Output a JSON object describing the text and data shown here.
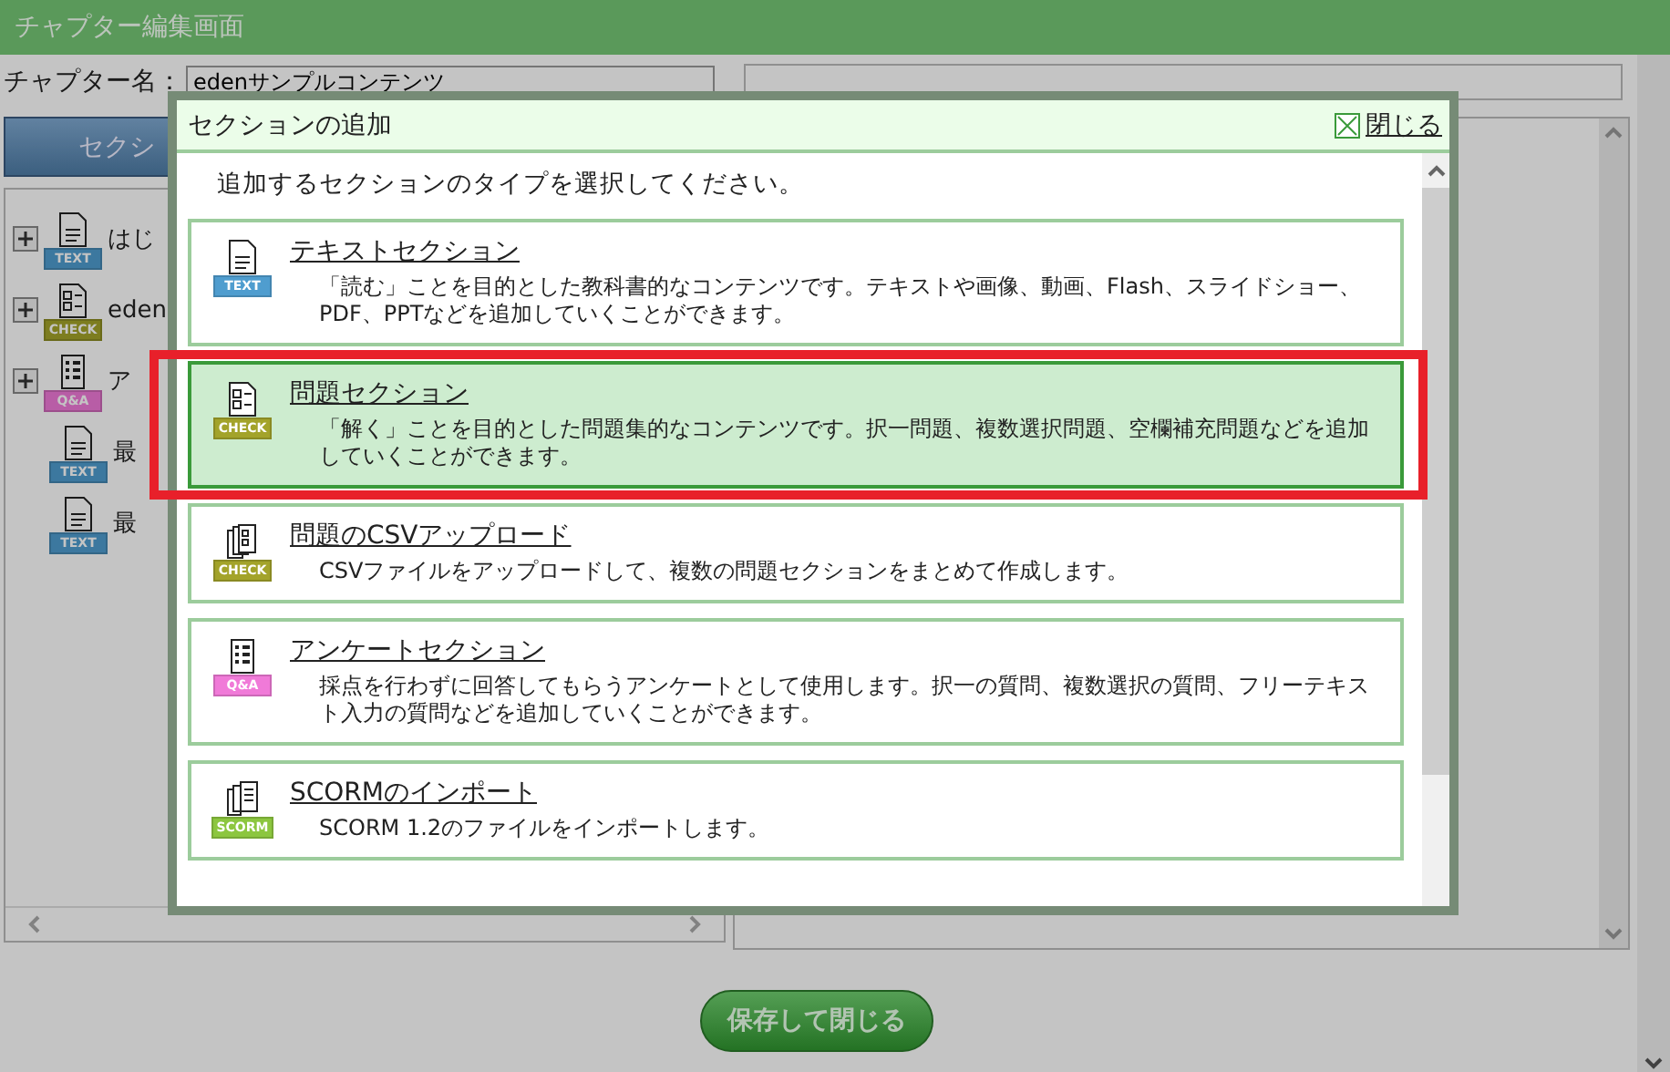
{
  "window": {
    "title": "チャプター編集画面"
  },
  "chapter_name": {
    "label": "チャプター名：",
    "value": "edenサンプルコンテンツ"
  },
  "section_button": "セクシ",
  "tree": [
    {
      "label": "はじ",
      "kind": "text",
      "badge": "TEXT",
      "expandable": true
    },
    {
      "label": "eden",
      "kind": "check",
      "badge": "CHECK",
      "expandable": true
    },
    {
      "label": "ア",
      "kind": "qa",
      "badge": "Q&A",
      "expandable": true
    },
    {
      "label": "最",
      "kind": "text",
      "badge": "TEXT",
      "expandable": false
    },
    {
      "label": "最",
      "kind": "text",
      "badge": "TEXT",
      "expandable": false
    }
  ],
  "save_button": "保存して閉じる",
  "dialog": {
    "title": "セクションの追加",
    "close": "閉じる",
    "instruction": "追加するセクションのタイプを選択してください。",
    "options": [
      {
        "title": "テキストセクション",
        "description": "「読む」ことを目的とした教科書的なコンテンツです。テキストや画像、動画、Flash、スライドショー、PDF、PPTなどを追加していくことができます。",
        "kind": "text",
        "badge": "TEXT",
        "selected": false
      },
      {
        "title": "問題セクション",
        "description": "「解く」ことを目的とした問題集的なコンテンツです。択一問題、複数選択問題、空欄補充問題などを追加していくことができます。",
        "kind": "check",
        "badge": "CHECK",
        "selected": true
      },
      {
        "title": "問題のCSVアップロード",
        "description": "CSVファイルをアップロードして、複数の問題セクションをまとめて作成します。",
        "kind": "csv",
        "badge": "CHECK",
        "selected": false
      },
      {
        "title": "アンケートセクション",
        "description": "採点を行わずに回答してもらうアンケートとして使用します。択一の質問、複数選択の質問、フリーテキスト入力の質問などを追加していくことができます。",
        "kind": "qa",
        "badge": "Q&A",
        "selected": false
      },
      {
        "title": "SCORMのインポート",
        "description": "SCORM 1.2のファイルをインポートします。",
        "kind": "scorm",
        "badge": "SCORM",
        "selected": false
      }
    ]
  }
}
